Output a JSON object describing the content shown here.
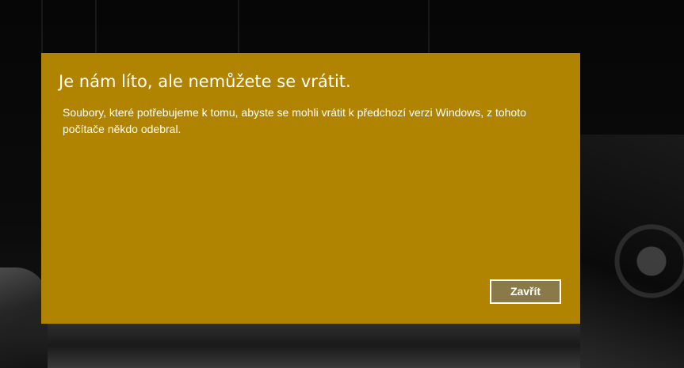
{
  "dialog": {
    "title": "Je nám líto, ale nemůžete se vrátit.",
    "message": "Soubory, které potřebujeme k tomu, abyste se mohli vrátit k předchozí verzi Windows, z tohoto počítače někdo odebral.",
    "close_label": "Zavřít",
    "background_color": "#b08300",
    "button_color": "#8a7a4a"
  }
}
